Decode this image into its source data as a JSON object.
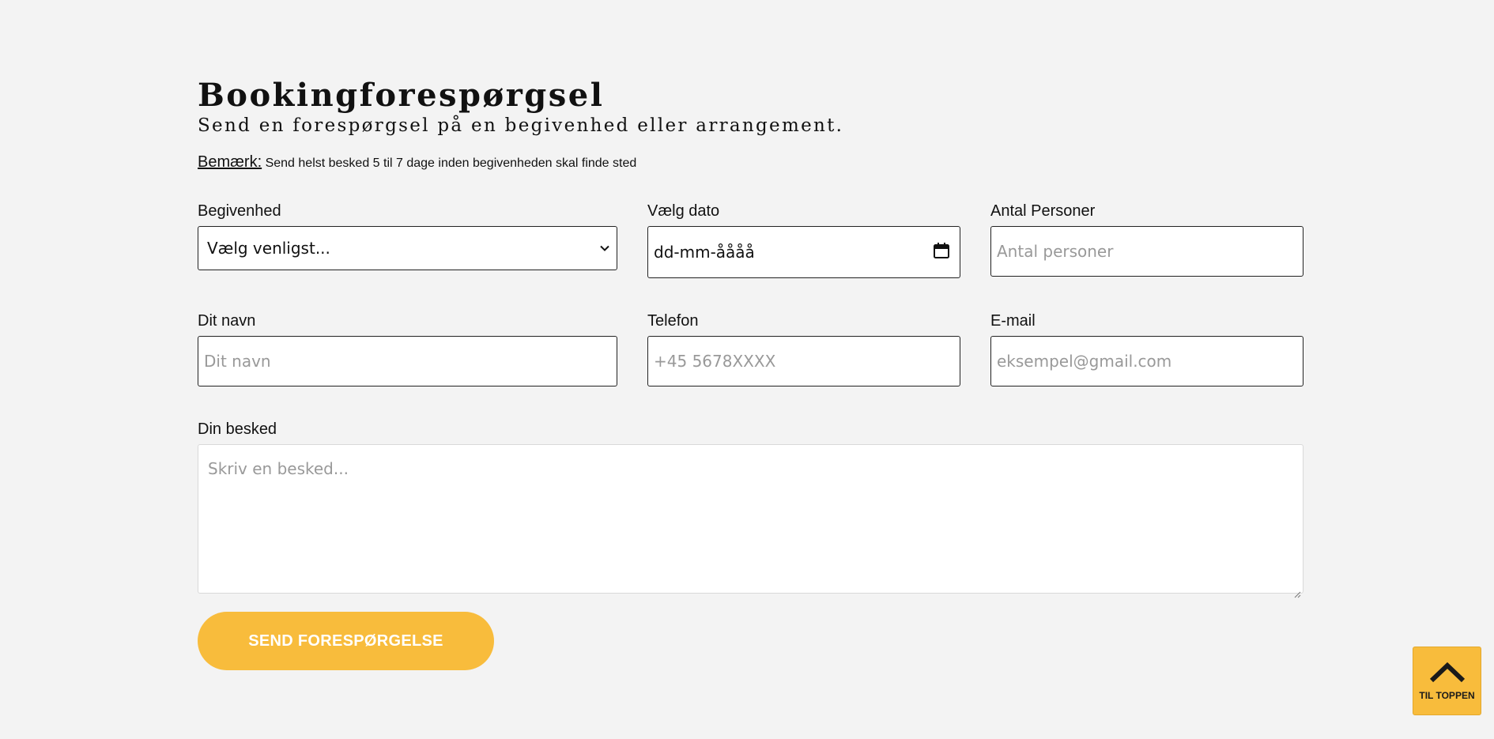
{
  "header": {
    "title": "Bookingforespørgsel",
    "subtitle": "Send en forespørgsel på en begivenhed eller arrangement.",
    "note_label": "Bemærk:",
    "note_text": "Send helst besked 5 til 7 dage inden begivenheden skal finde sted"
  },
  "form": {
    "event": {
      "label": "Begivenhed",
      "selected": "Vælg venligst..."
    },
    "date": {
      "label": "Vælg dato",
      "value": "dd-mm-åååå"
    },
    "persons": {
      "label": "Antal Personer",
      "placeholder": "Antal personer"
    },
    "name": {
      "label": "Dit navn",
      "placeholder": "Dit navn"
    },
    "phone": {
      "label": "Telefon",
      "placeholder": "+45 5678XXXX"
    },
    "email": {
      "label": "E-mail",
      "placeholder": "eksempel@gmail.com"
    },
    "message": {
      "label": "Din besked",
      "placeholder": "Skriv en besked..."
    },
    "submit_label": "SEND FORESPØRGELSE"
  },
  "to_top": {
    "label": "TIL TOPPEN",
    "icon": "chevron-up-icon"
  },
  "colors": {
    "background": "#f3f3f3",
    "accent": "#f8bc3c"
  }
}
